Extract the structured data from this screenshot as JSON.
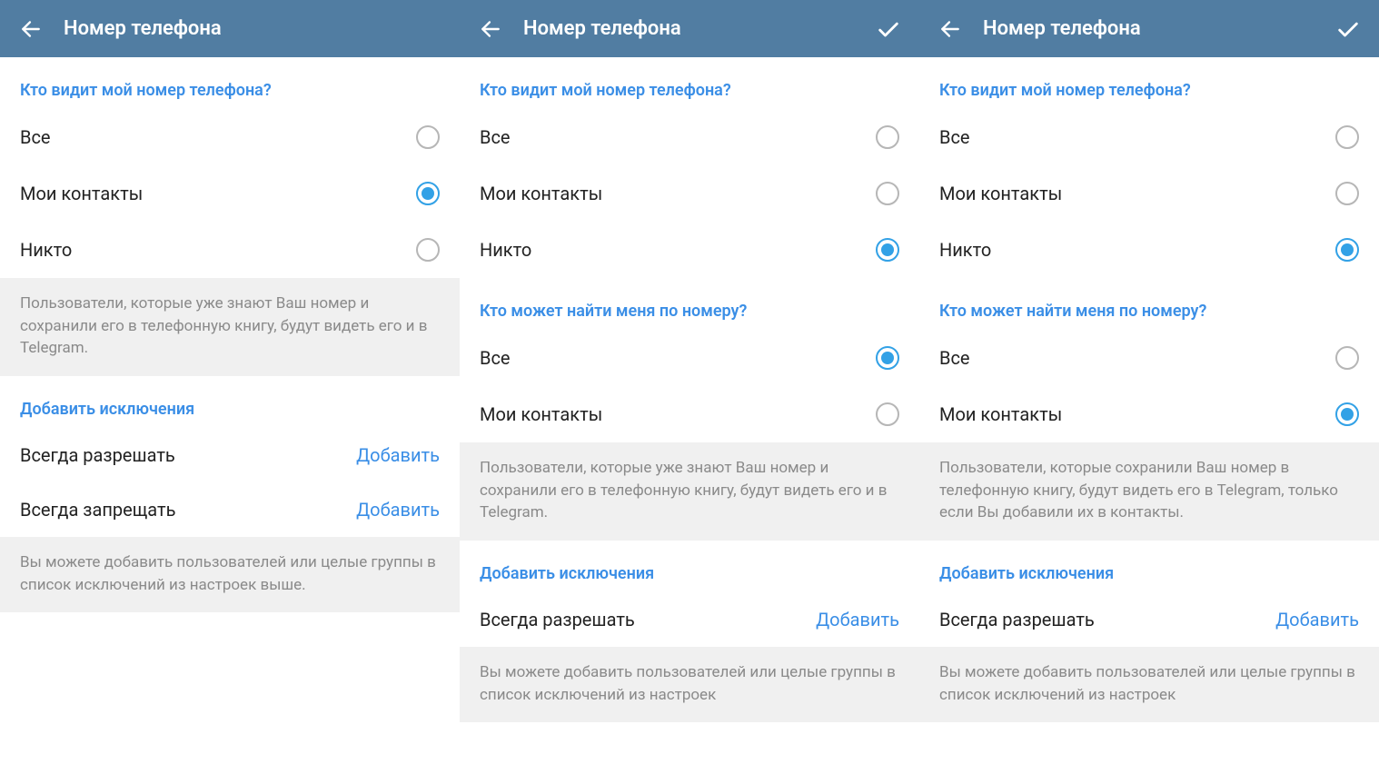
{
  "colors": {
    "toolbar": "#517da2",
    "accent": "#3a8ee6",
    "radio_selected": "#32a1e6",
    "info_bg": "#f0f0f0",
    "info_text": "#8a8a8a"
  },
  "screens": [
    {
      "toolbar": {
        "title": "Номер телефона",
        "show_confirm": false
      },
      "sections": [
        {
          "type": "radio",
          "title": "Кто видит мой номер телефона?",
          "options": [
            {
              "label": "Все",
              "selected": false
            },
            {
              "label": "Мои контакты",
              "selected": true
            },
            {
              "label": "Никто",
              "selected": false
            }
          ]
        },
        {
          "type": "info",
          "text": "Пользователи, которые уже знают Ваш номер и сохранили его в телефонную книгу, будут видеть его и в Telegram."
        },
        {
          "type": "actions",
          "title": "Добавить исключения",
          "rows": [
            {
              "label": "Всегда разрешать",
              "action": "Добавить"
            },
            {
              "label": "Всегда запрещать",
              "action": "Добавить"
            }
          ]
        },
        {
          "type": "info",
          "text": "Вы можете добавить пользователей или целые группы в список исключений из настроек выше."
        }
      ]
    },
    {
      "toolbar": {
        "title": "Номер телефона",
        "show_confirm": true
      },
      "sections": [
        {
          "type": "radio",
          "title": "Кто видит мой номер телефона?",
          "options": [
            {
              "label": "Все",
              "selected": false
            },
            {
              "label": "Мои контакты",
              "selected": false
            },
            {
              "label": "Никто",
              "selected": true
            }
          ]
        },
        {
          "type": "radio",
          "title": "Кто может найти меня по номеру?",
          "options": [
            {
              "label": "Все",
              "selected": true
            },
            {
              "label": "Мои контакты",
              "selected": false
            }
          ]
        },
        {
          "type": "info",
          "text": "Пользователи, которые уже знают Ваш номер и сохранили его в телефонную книгу, будут видеть его и в Telegram."
        },
        {
          "type": "actions",
          "title": "Добавить исключения",
          "rows": [
            {
              "label": "Всегда разрешать",
              "action": "Добавить"
            }
          ]
        },
        {
          "type": "info",
          "text": "Вы можете добавить пользователей или целые группы в список исключений из настроек"
        }
      ]
    },
    {
      "toolbar": {
        "title": "Номер телефона",
        "show_confirm": true
      },
      "sections": [
        {
          "type": "radio",
          "title": "Кто видит мой номер телефона?",
          "options": [
            {
              "label": "Все",
              "selected": false
            },
            {
              "label": "Мои контакты",
              "selected": false
            },
            {
              "label": "Никто",
              "selected": true
            }
          ]
        },
        {
          "type": "radio",
          "title": "Кто может найти меня по номеру?",
          "options": [
            {
              "label": "Все",
              "selected": false
            },
            {
              "label": "Мои контакты",
              "selected": true
            }
          ]
        },
        {
          "type": "info",
          "text": "Пользователи, которые сохранили Ваш номер в телефонную книгу, будут видеть его в Telegram, только если Вы добавили их в контакты."
        },
        {
          "type": "actions",
          "title": "Добавить исключения",
          "rows": [
            {
              "label": "Всегда разрешать",
              "action": "Добавить"
            }
          ]
        },
        {
          "type": "info",
          "text": "Вы можете добавить пользователей или целые группы в список исключений из настроек"
        }
      ]
    }
  ]
}
